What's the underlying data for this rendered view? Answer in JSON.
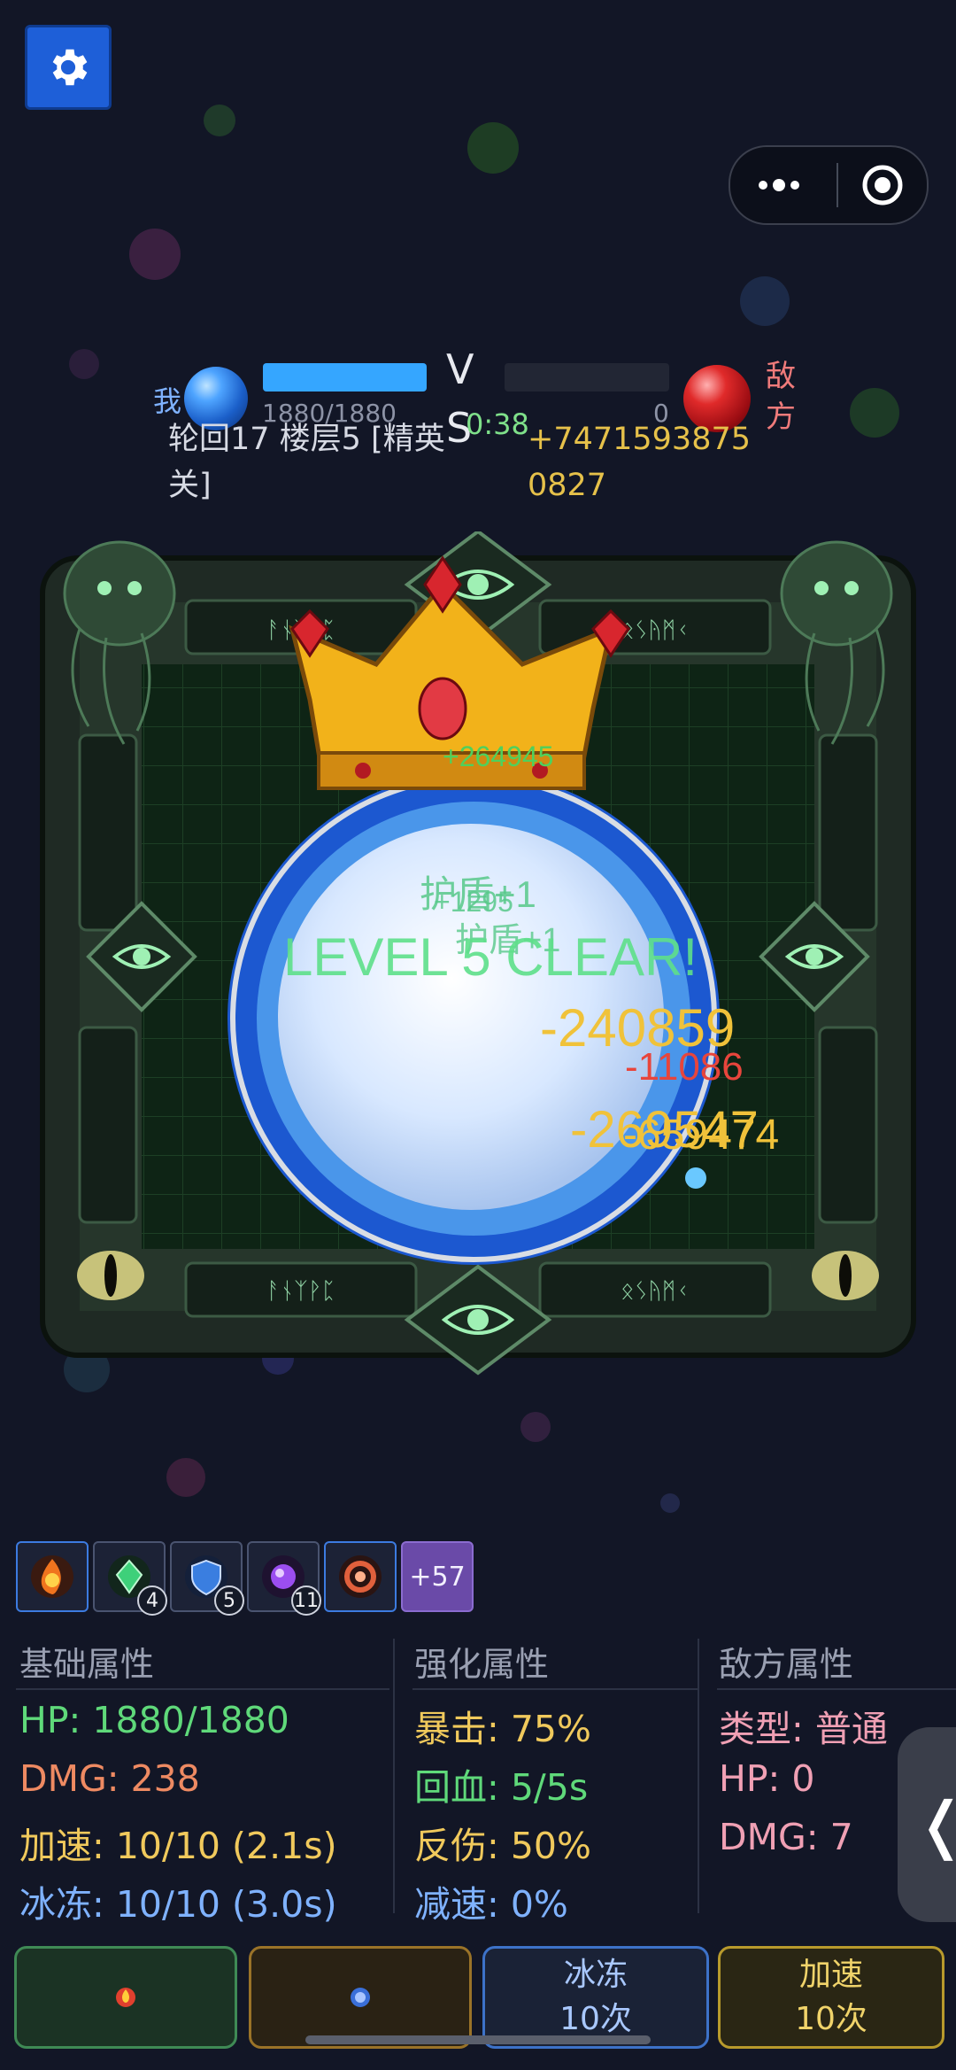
{
  "header": {
    "settings_icon": "gear-icon",
    "capsule": {
      "more_icon": "more-dots-icon",
      "close_icon": "target-close-icon"
    }
  },
  "battle": {
    "me_label": "我",
    "me_hp_text": "1880/1880",
    "me_hp_fraction": 1.0,
    "vs_v": "V",
    "vs_s": "S",
    "timer": "0:38",
    "enemy_hp_text": "0",
    "enemy_hp_fraction": 0.0,
    "enemy_label": "敌方",
    "stage": "轮回17 楼层5 [精英关]",
    "score": "+74715938750827"
  },
  "arena": {
    "combat_texts": [
      {
        "text": "+264945",
        "color": "#4fd05c"
      },
      {
        "text": "护盾+1",
        "color": "#58c98a"
      },
      {
        "text": "+1295",
        "color": "#58c98a"
      },
      {
        "text": "护盾+1",
        "color": "#58c98a"
      },
      {
        "text": "LEVEL 5 CLEAR!",
        "color": "#5ee08a"
      },
      {
        "text": "-240859",
        "color": "#f0c23a"
      },
      {
        "text": "-11086",
        "color": "#e8453c"
      },
      {
        "text": "-269547",
        "color": "#f0c23a"
      },
      {
        "text": "-659474",
        "color": "#f0c23a"
      }
    ]
  },
  "skills": [
    {
      "icon": "fire-burst-icon",
      "count": ""
    },
    {
      "icon": "green-gem-icon",
      "count": "4"
    },
    {
      "icon": "blue-shield-icon",
      "count": "5"
    },
    {
      "icon": "purple-orb-icon",
      "count": "11"
    },
    {
      "icon": "red-vortex-icon",
      "count": ""
    }
  ],
  "skills_more": "+57",
  "stats": {
    "basic": {
      "title": "基础属性",
      "hp": "HP: 1880/1880",
      "dmg": "DMG: 238",
      "speed": "加速: 10/10 (2.1s)",
      "freeze": "冰冻: 10/10 (3.0s)"
    },
    "enhanced": {
      "title": "强化属性",
      "crit": "暴击: 75%",
      "regen": "回血: 5/5s",
      "reflect": "反伤: 50%",
      "slow": "减速: 0%"
    },
    "enemy": {
      "title": "敌方属性",
      "type": "类型: 普通",
      "hp": "HP: 0",
      "dmg": "DMG: 7"
    }
  },
  "buttons": {
    "b1_icon": "fire-potion-icon",
    "b2_icon": "shield-icon",
    "freeze_line1": "冰冻",
    "freeze_line2": "10次",
    "speed_line1": "加速",
    "speed_line2": "10次"
  },
  "side_tab_label": "❬",
  "colors": {
    "background": "#121626",
    "green": "#5fd97a",
    "orange": "#ee8a62",
    "yellow": "#f0c95c",
    "blue": "#7fb2ff",
    "pink": "#f0a0b4"
  }
}
